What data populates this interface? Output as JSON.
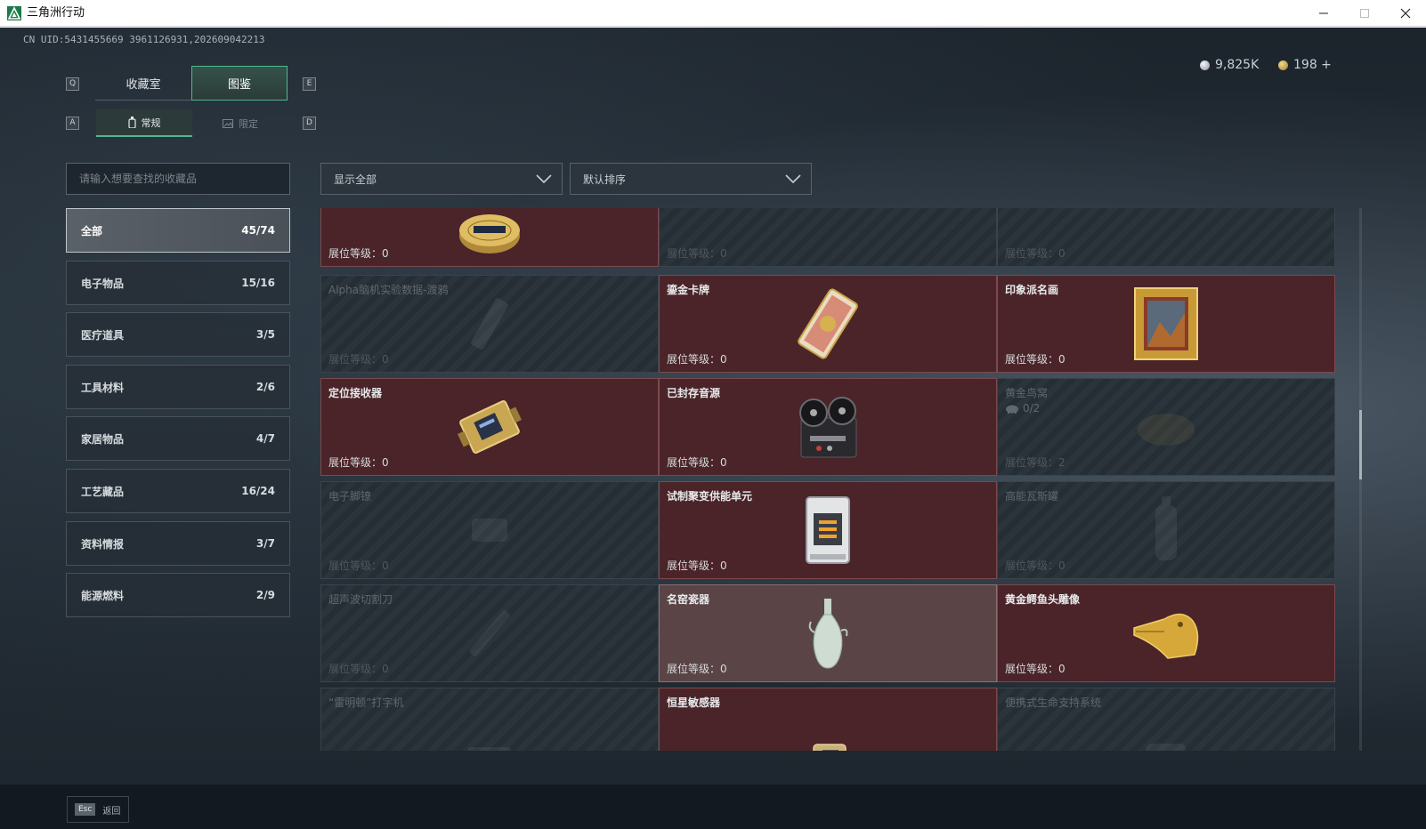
{
  "window": {
    "title": "三角洲行动"
  },
  "header": {
    "uid": "CN UID:5431455669 3961126931,202609042213",
    "main_tabs": [
      {
        "label": "收藏室"
      },
      {
        "label": "图鉴"
      }
    ],
    "sub_tabs": [
      {
        "label": "常规"
      },
      {
        "label": "限定"
      }
    ],
    "keys": {
      "prev_main": "Q",
      "next_main": "E",
      "prev_sub": "A",
      "next_sub": "D"
    },
    "currency": [
      {
        "value": "9,825K",
        "color": "#c9ced2"
      },
      {
        "value": "198 +",
        "color": "#d8b65a"
      }
    ]
  },
  "filters": {
    "search_placeholder": "请输入想要查找的收藏品",
    "show": "显示全部",
    "sort": "默认排序"
  },
  "categories": [
    {
      "label": "全部",
      "count": "45/74"
    },
    {
      "label": "电子物品",
      "count": "15/16"
    },
    {
      "label": "医疗道具",
      "count": "3/5"
    },
    {
      "label": "工具材料",
      "count": "2/6"
    },
    {
      "label": "家居物品",
      "count": "4/7"
    },
    {
      "label": "工艺藏品",
      "count": "16/24"
    },
    {
      "label": "资料情报",
      "count": "3/7"
    },
    {
      "label": "能源燃料",
      "count": "2/9"
    }
  ],
  "items": [
    {
      "name": "",
      "level": "展位等级：0",
      "owned": true,
      "icon": "caviar-tin-icon"
    },
    {
      "name": "",
      "level": "展位等级：0",
      "owned": false,
      "icon": "locked-item-icon"
    },
    {
      "name": "",
      "level": "展位等级：0",
      "owned": false,
      "icon": "locked-item-icon"
    },
    {
      "name": "Alpha脑机实验数据-渡鸦",
      "level": "展位等级：0",
      "owned": false,
      "icon": "data-drive-icon"
    },
    {
      "name": "鎏金卡牌",
      "level": "展位等级：0",
      "owned": true,
      "icon": "gilded-card-icon"
    },
    {
      "name": "印象派名画",
      "level": "展位等级：0",
      "owned": true,
      "icon": "painting-icon"
    },
    {
      "name": "定位接收器",
      "level": "展位等级：0",
      "owned": true,
      "icon": "gps-receiver-icon"
    },
    {
      "name": "已封存音源",
      "level": "展位等级：0",
      "owned": true,
      "icon": "reel-recorder-icon"
    },
    {
      "name": "黄金鸟窝",
      "level": "展位等级：2",
      "owned": false,
      "icon": "golden-nest-icon",
      "progress": "0/2"
    },
    {
      "name": "电子脚镣",
      "level": "展位等级：0",
      "owned": false,
      "icon": "ankle-monitor-icon"
    },
    {
      "name": "试制聚变供能单元",
      "level": "展位等级：0",
      "owned": true,
      "icon": "fusion-cell-icon"
    },
    {
      "name": "高能瓦斯罐",
      "level": "展位等级：0",
      "owned": false,
      "icon": "gas-tank-icon"
    },
    {
      "name": "超声波切割刀",
      "level": "展位等级：0",
      "owned": false,
      "icon": "ultrasonic-knife-icon"
    },
    {
      "name": "名窑瓷器",
      "level": "展位等级：0",
      "owned": true,
      "icon": "porcelain-vase-icon"
    },
    {
      "name": "黄金鳄鱼头雕像",
      "level": "展位等级：0",
      "owned": true,
      "icon": "gold-croc-head-icon"
    },
    {
      "name": "“雷明顿”打字机",
      "level": "",
      "owned": false,
      "icon": "typewriter-icon"
    },
    {
      "name": "恒星敏感器",
      "level": "",
      "owned": true,
      "icon": "star-sensor-icon"
    },
    {
      "name": "便携式生命支持系统",
      "level": "",
      "owned": false,
      "icon": "life-support-icon"
    }
  ],
  "footer": {
    "esc_key": "Esc",
    "esc_label": "返回"
  }
}
